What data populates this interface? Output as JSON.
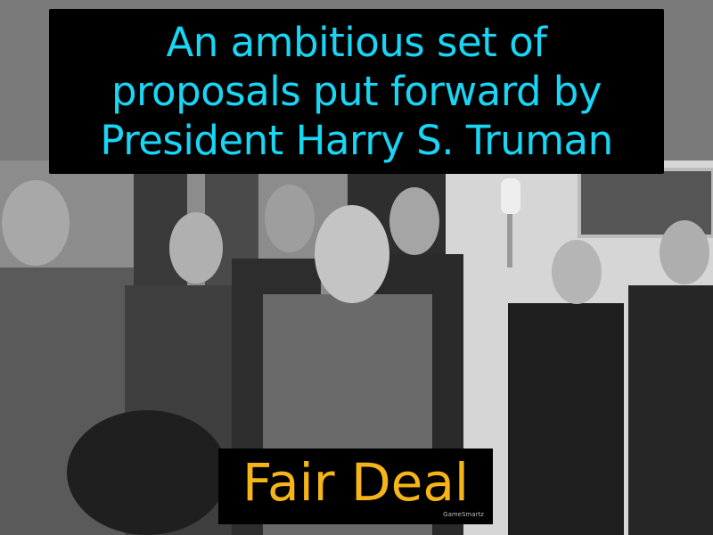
{
  "definition": {
    "lines": [
      "An ambitious set of",
      "proposals put forward by",
      "President Harry S. Truman"
    ],
    "color": "#19d6f5"
  },
  "term": {
    "label": "Fair Deal",
    "color": "#f5b418"
  },
  "brand": {
    "label": "GameSmartz"
  },
  "photo": {
    "style": "black-and-white photograph of a group of men in suits"
  }
}
